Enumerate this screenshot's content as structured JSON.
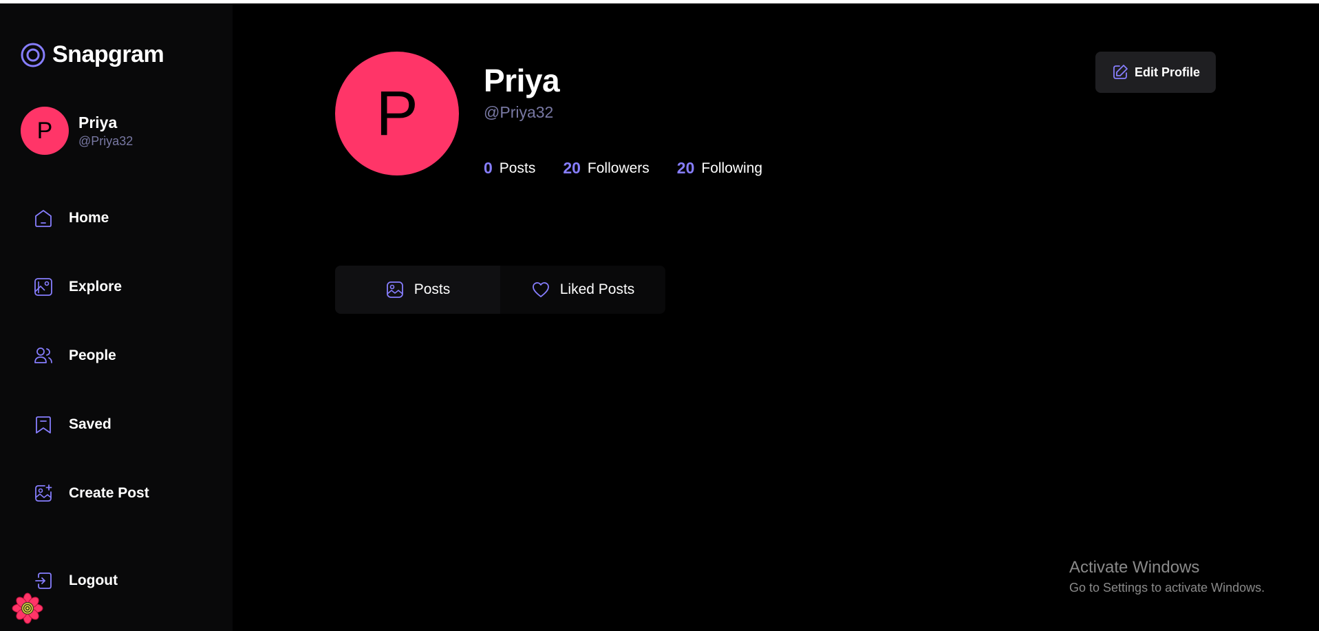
{
  "app": {
    "name": "Snapgram"
  },
  "sidebar": {
    "user": {
      "initial": "P",
      "name": "Priya",
      "handle": "@Priya32"
    },
    "items": [
      {
        "label": "Home",
        "icon": "home-icon"
      },
      {
        "label": "Explore",
        "icon": "wallpaper-icon"
      },
      {
        "label": "People",
        "icon": "people-icon"
      },
      {
        "label": "Saved",
        "icon": "bookmark-icon"
      },
      {
        "label": "Create Post",
        "icon": "gallery-add-icon"
      }
    ],
    "logout_label": "Logout"
  },
  "profile": {
    "initial": "P",
    "name": "Priya",
    "handle": "@Priya32",
    "stats": [
      {
        "value": "0",
        "label": "Posts"
      },
      {
        "value": "20",
        "label": "Followers"
      },
      {
        "value": "20",
        "label": "Following"
      }
    ],
    "edit_label": "Edit Profile"
  },
  "tabs": [
    {
      "label": "Posts",
      "icon": "posts-icon",
      "active": true
    },
    {
      "label": "Liked Posts",
      "icon": "heart-icon",
      "active": false
    }
  ],
  "watermark": {
    "title": "Activate Windows",
    "subtitle": "Go to Settings to activate Windows."
  },
  "colors": {
    "accent": "#877eff",
    "avatar": "#ff3568",
    "muted": "#7878a3",
    "sidebar_bg": "#09090a",
    "button_bg": "#1f1f22"
  }
}
